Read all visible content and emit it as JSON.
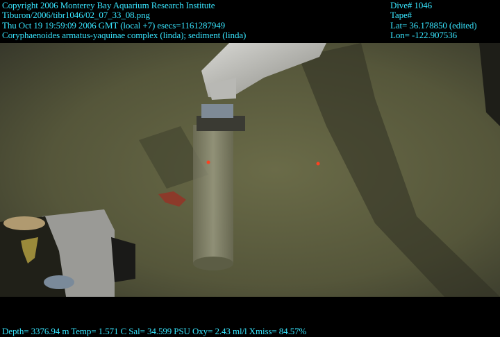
{
  "overlay": {
    "top_left": [
      "Copyright 2006 Monterey Bay Aquarium Research Institute",
      "Tiburon/2006/tibr1046/02_07_33_08.png",
      "Thu Oct 19 19:59:09 2006 GMT (local +7)  esecs=1161287949",
      "Coryphaenoides armatus-yaquinae complex (linda); sediment (linda)"
    ],
    "top_right": [
      "Dive# 1046",
      "Tape#",
      "Lat= 36.178850 (edited)",
      "Lon= -122.907536"
    ],
    "bottom": "Depth= 3376.94 m  Temp= 1.571 C  Sal= 34.599 PSU  Oxy= 2.43 ml/l  Xmiss= 84.57%"
  },
  "colors": {
    "overlay_text": "#38e6ff",
    "seafloor": "#5a5a3c",
    "background": "#000000"
  }
}
